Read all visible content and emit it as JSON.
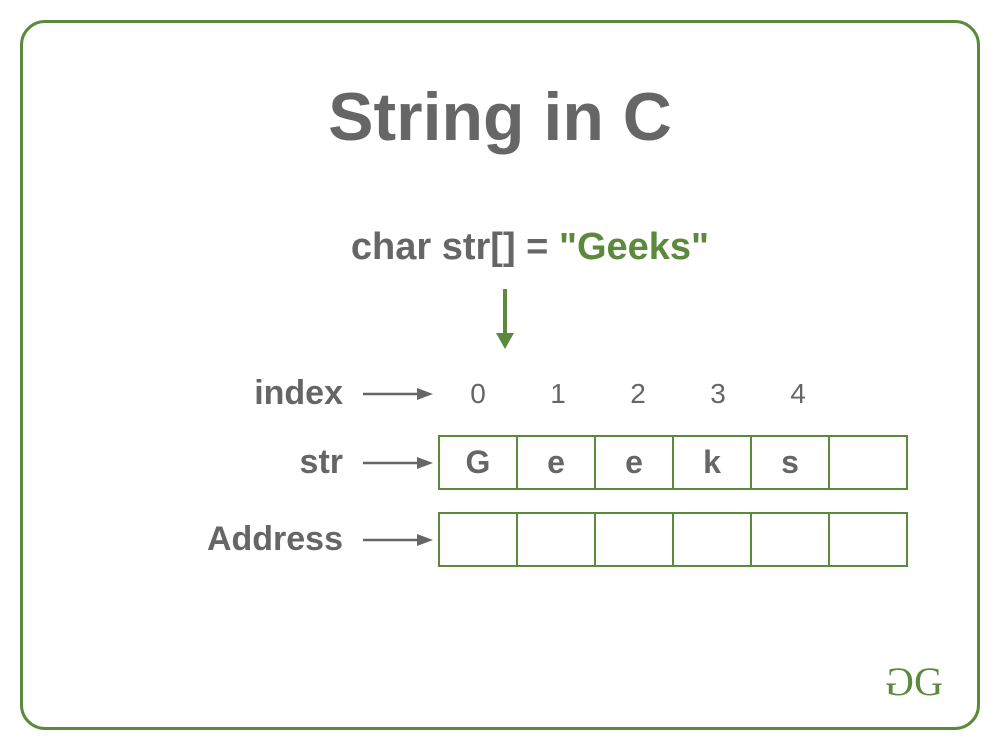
{
  "title": "String in C",
  "declaration": {
    "prefix": "char str[] = ",
    "value": "\"Geeks\""
  },
  "rows": {
    "index": {
      "label": "index",
      "values": [
        "0",
        "1",
        "2",
        "3",
        "4"
      ]
    },
    "str": {
      "label": "str",
      "cells": [
        "G",
        "e",
        "e",
        "k",
        "s",
        ""
      ]
    },
    "address": {
      "label": "Address",
      "cells": [
        "",
        "",
        "",
        "",
        "",
        ""
      ]
    }
  },
  "colors": {
    "border": "#5b8a3d",
    "text": "#666",
    "accent": "#5b8a3d"
  }
}
